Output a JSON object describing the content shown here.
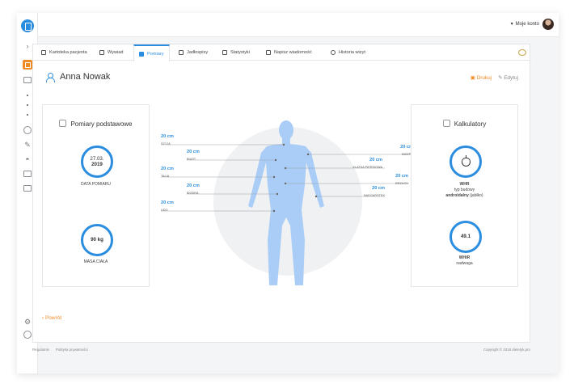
{
  "topbar": {
    "account_label": "Moje konto",
    "caret": "▾"
  },
  "tabs": [
    {
      "label": "Kartoteka pacjenta"
    },
    {
      "label": "Wywiad"
    },
    {
      "label": "Pomiary"
    },
    {
      "label": "Jadłospisy"
    },
    {
      "label": "Statystyki"
    },
    {
      "label": "Napisz wiadomość"
    },
    {
      "label": "Historia wizyt"
    }
  ],
  "patient": {
    "name": "Anna Nowak"
  },
  "actions": {
    "print": "Drukuj",
    "edit": "Edytuj"
  },
  "basic": {
    "title": "Pomiary podstawowe",
    "date_day": "27.03.",
    "date_year": "2019",
    "date_caption": "DATA POMIARU",
    "weight_value": "90 kg",
    "weight_caption": "MASA CIAŁA"
  },
  "calculators": {
    "title": "Kalkulatory",
    "whr_label": "WHR",
    "whr_line1": "typ budowy",
    "whr_line2_bold": "androidalny",
    "whr_line2_rest": " (jabłko)",
    "whtr_value": "49.1",
    "whtr_label": "WHtR",
    "whtr_desc": "nadwaga"
  },
  "measurements": [
    {
      "value": "20 cm",
      "name": "SZYJA"
    },
    {
      "value": "20 cm",
      "name": "BIUST"
    },
    {
      "value": "20 cm",
      "name": "TALIA"
    },
    {
      "value": "20 cm",
      "name": "BIODRA"
    },
    {
      "value": "20 cm",
      "name": "UDO"
    },
    {
      "value": "20 cm",
      "name": "BICEPS"
    },
    {
      "value": "20 cm",
      "name": "KLATKA PIERSIOWA"
    },
    {
      "value": "20 cm",
      "name": "BRZUCH"
    },
    {
      "value": "20 cm",
      "name": "NADGARSTEK"
    }
  ],
  "back_link": "‹  Powrót",
  "footer": {
    "links": [
      "Regulamin",
      "Polityka prywatności"
    ],
    "copyright": "Copyright © 2018 dietetyk.pro"
  },
  "colors": {
    "accent": "#2b8de0",
    "orange": "#f08a24",
    "body": "#a9cdf6"
  }
}
